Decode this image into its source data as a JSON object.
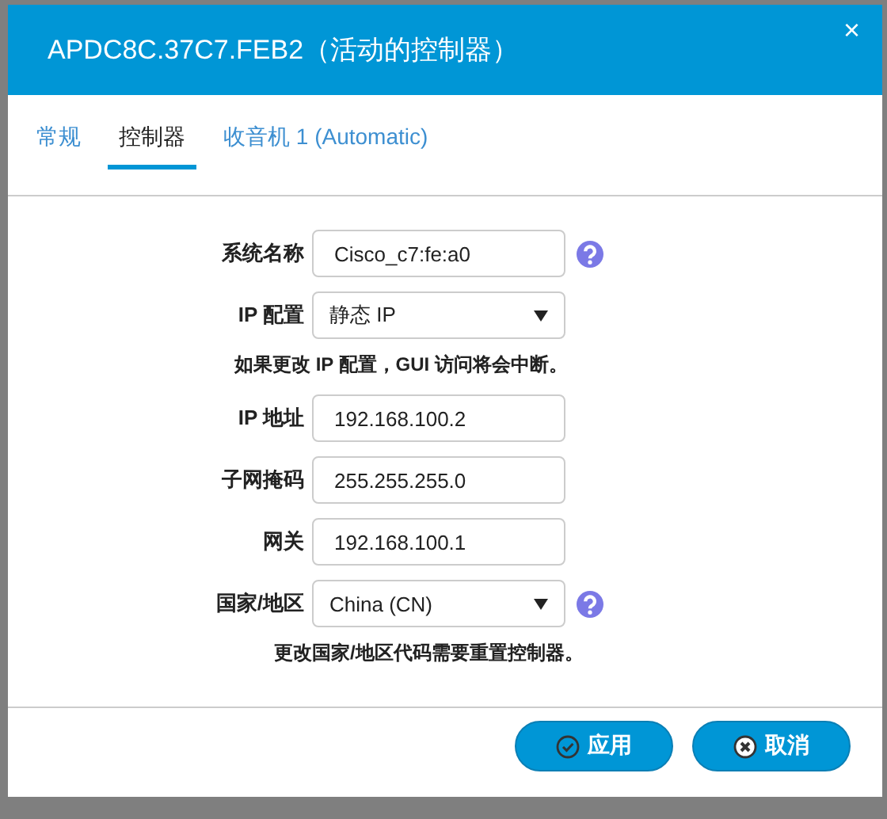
{
  "dialog": {
    "title": "APDC8C.37C7.FEB2（活动的控制器）",
    "close": "×"
  },
  "tabs": [
    {
      "label": "常规",
      "selected": false
    },
    {
      "label": "控制器",
      "selected": true
    },
    {
      "label": "收音机 1 (Automatic)",
      "selected": false
    }
  ],
  "form": [
    {
      "kind": "text",
      "label": "系统名称",
      "value": "Cisco_c7:fe:a0",
      "help": true
    },
    {
      "kind": "select",
      "label": "IP 配置",
      "value": "静态 IP",
      "help": false
    },
    {
      "kind": "note",
      "text": "如果更改 IP 配置，GUI 访问将会中断。"
    },
    {
      "kind": "text",
      "label": "IP 地址",
      "value": "192.168.100.2",
      "help": false
    },
    {
      "kind": "text",
      "label": "子网掩码",
      "value": "255.255.255.0",
      "help": false
    },
    {
      "kind": "text",
      "label": "网关",
      "value": "192.168.100.1",
      "help": false
    },
    {
      "kind": "select",
      "label": "国家/地区",
      "value": "China (CN)",
      "help": true
    },
    {
      "kind": "note",
      "text": "更改国家/地区代码需要重置控制器。"
    }
  ],
  "buttons": [
    {
      "kind": "apply",
      "label": "应用"
    },
    {
      "kind": "cancel",
      "label": "取消"
    }
  ]
}
